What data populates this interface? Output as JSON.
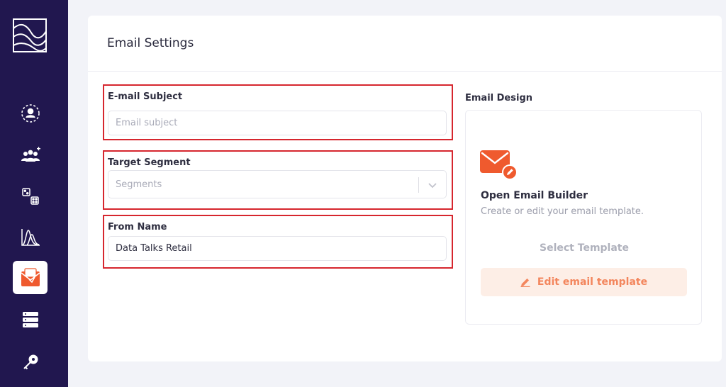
{
  "card": {
    "title": "Email Settings"
  },
  "form": {
    "subject": {
      "label": "E-mail Subject",
      "value": "",
      "placeholder": "Email subject"
    },
    "segment": {
      "label": "Target Segment",
      "placeholder": "Segments"
    },
    "from_name": {
      "label": "From Name",
      "value": "Data Talks Retail",
      "placeholder": ""
    }
  },
  "design": {
    "label": "Email Design",
    "builder_title": "Open Email Builder",
    "builder_subtitle": "Create or edit your email template.",
    "select_template": "Select Template",
    "edit_button": "Edit email template"
  },
  "sidebar": {
    "items": [
      {
        "icon": "user-circle-icon"
      },
      {
        "icon": "users-add-icon"
      },
      {
        "icon": "dice-icon"
      },
      {
        "icon": "distribution-chart-icon"
      },
      {
        "icon": "email-campaign-icon",
        "active": true
      },
      {
        "icon": "database-icon"
      },
      {
        "icon": "key-icon"
      }
    ]
  },
  "colors": {
    "sidebar_bg": "#21174f",
    "accent": "#ef5a2e",
    "highlight_border": "#d6262e",
    "edit_button_bg": "#fdeee6",
    "edit_button_text": "#f3865d"
  }
}
